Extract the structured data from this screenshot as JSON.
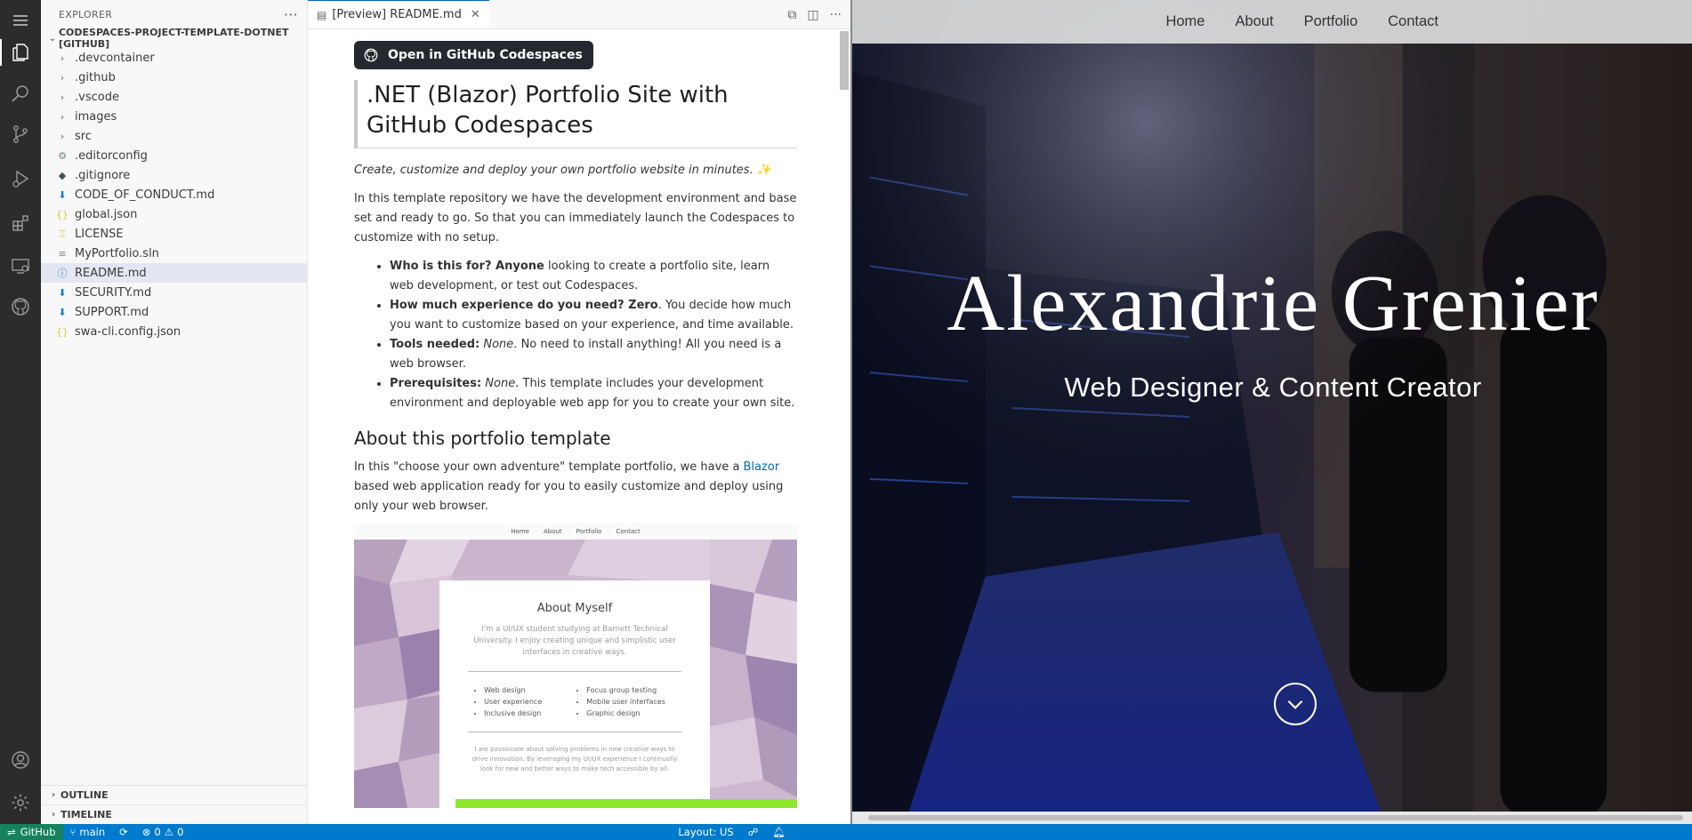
{
  "activity_bar": {
    "items": [
      "menu-icon",
      "files-icon",
      "search-icon",
      "source-control-icon",
      "run-debug-icon",
      "extensions-icon",
      "remote-explorer-icon",
      "github-icon"
    ],
    "bottom": [
      "account-icon",
      "settings-icon"
    ]
  },
  "explorer": {
    "title": "EXPLORER",
    "more": "···",
    "root": "CODESPACES-PROJECT-TEMPLATE-DOTNET [GITHUB]",
    "folders": [
      ".devcontainer",
      ".github",
      ".vscode",
      "images",
      "src"
    ],
    "files": [
      {
        "name": ".editorconfig",
        "icon": "gear"
      },
      {
        "name": ".gitignore",
        "icon": "git"
      },
      {
        "name": "CODE_OF_CONDUCT.md",
        "icon": "md"
      },
      {
        "name": "global.json",
        "icon": "json"
      },
      {
        "name": "LICENSE",
        "icon": "license"
      },
      {
        "name": "MyPortfolio.sln",
        "icon": "sln"
      },
      {
        "name": "README.md",
        "icon": "info"
      },
      {
        "name": "SECURITY.md",
        "icon": "md"
      },
      {
        "name": "SUPPORT.md",
        "icon": "md"
      },
      {
        "name": "swa-cli.config.json",
        "icon": "json"
      }
    ],
    "selected_file": "README.md",
    "outline": "OUTLINE",
    "timeline": "TIMELINE"
  },
  "editor": {
    "tab_label": "[Preview] README.md",
    "readme": {
      "codespaces_button": "Open in GitHub Codespaces",
      "h1": ".NET (Blazor) Portfolio Site with GitHub Codespaces",
      "tagline": "Create, customize and deploy your own portfolio website in minutes. ✨",
      "intro": "In this template repository we have the development environment and base set and ready to go. So that you can immediately launch the Codespaces to customize with no setup.",
      "bullets": [
        {
          "bold": "Who is this for? Anyone",
          "text": " looking to create a portfolio site, learn web development, or test out Codespaces."
        },
        {
          "bold": "How much experience do you need? Zero",
          "text": ". You decide how much you want to customize based on your experience, and time available."
        },
        {
          "bold": "Tools needed:",
          "italic": " None",
          "text": ". No need to install anything! All you need is a web browser."
        },
        {
          "bold": "Prerequisites:",
          "italic": " None",
          "text": ". This template includes your development environment and deployable web app for you to create your own site."
        }
      ],
      "h2": "About this portfolio template",
      "about_pre": "In this \"choose your own adventure\" template portfolio, we have a ",
      "about_link": "Blazor",
      "about_post": " based web application ready for you to easily customize and deploy using only your web browser.",
      "screenshot": {
        "nav": [
          "Home",
          "About",
          "Portfolio",
          "Contact"
        ],
        "title": "About Myself",
        "text": "I'm a UI/UX student studying at Barnett Technical University. I enjoy creating unique and simplistic user interfaces in creative ways.",
        "col1": [
          "Web design",
          "User experience",
          "Inclusive design"
        ],
        "col2": [
          "Focus group testing",
          "Mobile user interfaces",
          "Graphic design"
        ],
        "text2": "I am passionate about solving problems in new creative ways to drive innovation. By leveraging my UI/UX experience I continually look for new and better ways to make tech accessible by all."
      }
    }
  },
  "web_preview": {
    "nav": [
      "Home",
      "About",
      "Portfolio",
      "Contact"
    ],
    "name": "Alexandrie Grenier",
    "subtitle": "Web Designer & Content Creator"
  },
  "status_bar": {
    "remote": "GitHub",
    "branch": "main",
    "errors": "0",
    "warnings": "0",
    "layout": "Layout: US"
  },
  "colors": {
    "status_bar": "#007acc",
    "remote": "#16825d",
    "activity_bar": "#2c2c2c",
    "sidebar": "#f8f8f8"
  }
}
